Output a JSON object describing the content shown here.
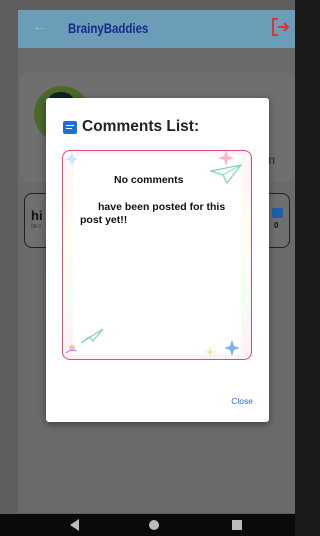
{
  "app": {
    "title": "BrainyBaddies",
    "back_icon": "arrow-left-icon",
    "logout_icon": "logout-icon"
  },
  "background": {
    "partial_text": "n",
    "post": {
      "text": "hi",
      "timestamp": "08-0",
      "comment_count": "0"
    }
  },
  "dialog": {
    "title": "Comments List:",
    "title_icon": "comment-icon",
    "message_line1": "No comments",
    "message_line2": "have been posted for this",
    "message_line3": "post yet!!",
    "close_label": "Close"
  },
  "colors": {
    "accent": "#1e6fd9",
    "border_pink": "#e04a7a",
    "appbar": "#6b9cb8",
    "title_navy": "#1a2a8a",
    "logout_red": "#e0303a"
  },
  "navbar": {
    "icons": [
      "nav-back-icon",
      "nav-home-icon",
      "nav-recents-icon"
    ]
  }
}
